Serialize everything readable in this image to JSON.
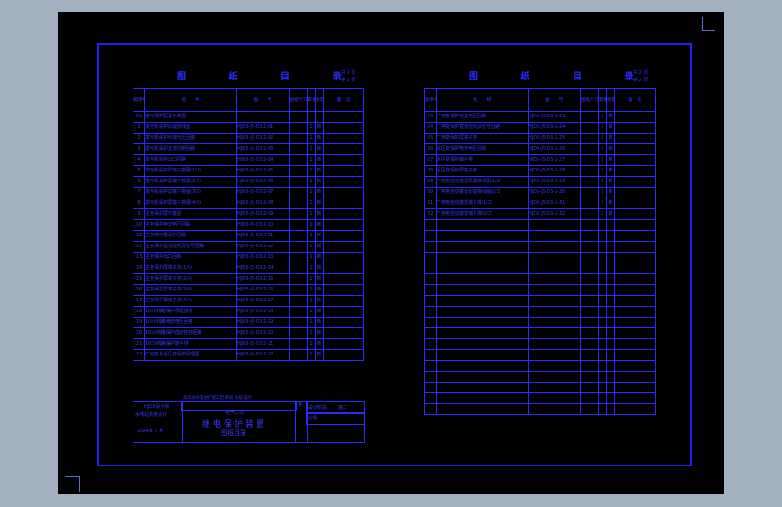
{
  "left_sheet": {
    "title": "图 纸 目 录",
    "page_total": "共 2 页",
    "page_no": "第 1 页",
    "headers": [
      "顺序号",
      "名　　称",
      "图　　号",
      "图纸尺寸",
      "数量",
      "张数",
      "备　注"
    ],
    "rows": [
      [
        "01",
        "继电保护配置示意图",
        "",
        "",
        "",
        "",
        ""
      ],
      [
        "1",
        "发电机保护原理接线图",
        "HJD3-J5-03-2-01",
        "",
        "1",
        "新",
        ""
      ],
      [
        "2",
        "发电机保护电流电压回路",
        "HJD3-J5-03-2-02",
        "",
        "1",
        "新",
        ""
      ],
      [
        "3",
        "发电机保护直流控制回路",
        "HJD3-J5-03-2-03",
        "",
        "1",
        "新",
        ""
      ],
      [
        "4",
        "发电机保护出口回路",
        "HJD3-J5-03-2-04",
        "",
        "1",
        "新",
        ""
      ],
      [
        "5",
        "发电机保护屏端子排图(1/3)",
        "HJD3-J5-03-2-05",
        "",
        "1",
        "新",
        ""
      ],
      [
        "6",
        "发电机保护屏端子排图(2/3)",
        "HJD3-J5-03-2-06",
        "",
        "1",
        "新",
        ""
      ],
      [
        "7",
        "发电机保护屏端子排图(3/3)",
        "HJD3-J5-03-2-07",
        "",
        "1",
        "新",
        ""
      ],
      [
        "8",
        "发电机保护屏端子排图(4/4)",
        "HJD3-J5-03-2-08",
        "",
        "1",
        "新",
        ""
      ],
      [
        "9",
        "主变保护屏布置图",
        "HJD3-J5-03-2-09",
        "",
        "1",
        "新",
        ""
      ],
      [
        "10",
        "主变保护电流电压回路",
        "HJD3-J5-03-2-10",
        "",
        "1",
        "新",
        ""
      ],
      [
        "11",
        "主变非电量保护回路",
        "HJD3-J5-03-2-11",
        "",
        "1",
        "新",
        ""
      ],
      [
        "12",
        "主变保护直流控制及信号回路",
        "HJD3-J5-03-2-12",
        "",
        "1",
        "新",
        ""
      ],
      [
        "13",
        "主变保护出口回路",
        "HJD3-J5-03-2-13",
        "",
        "1",
        "新",
        ""
      ],
      [
        "14",
        "主变保护屏端子排(1/4)",
        "HJD3-J5-03-2-14",
        "",
        "1",
        "新",
        ""
      ],
      [
        "15",
        "主变保护屏端子排(2/4)",
        "HJD3-J5-03-2-15",
        "",
        "1",
        "新",
        ""
      ],
      [
        "16",
        "主变保护屏端子排(3/4)",
        "HJD3-J5-03-2-16",
        "",
        "1",
        "新",
        ""
      ],
      [
        "17",
        "主变保护屏端子排(4/4)",
        "HJD3-J5-03-2-17",
        "",
        "1",
        "新",
        ""
      ],
      [
        "18",
        "10kV线路保护原理接线",
        "HJD3-J5-03-2-18",
        "",
        "1",
        "新",
        ""
      ],
      [
        "19",
        "10kV线路电流电压回路",
        "HJD3-J5-03-2-19",
        "",
        "1",
        "新",
        ""
      ],
      [
        "20",
        "10kV线路保护直流控制回路",
        "HJD3-J5-03-2-20",
        "",
        "1",
        "新",
        ""
      ],
      [
        "21",
        "10kV线路保护端子排",
        "HJD3-J5-03-2-21",
        "",
        "1",
        "新",
        ""
      ],
      [
        "22",
        "厂用变及近区变保护原理图",
        "HJD3-J5-03-2-22",
        "",
        "1",
        "新",
        ""
      ]
    ],
    "titleblock": {
      "org1": "HJD3设计院",
      "org2": "水电站机电设计",
      "date": "2004年 7 月",
      "proj_line": "高坝洲水电站扩建工程  审核  校核  设计",
      "dept": "电气二次",
      "name1": "继电保护装置",
      "name2": "图纸目录",
      "stage_label": "设计阶段",
      "stage": "施工",
      "scale_label": "比例",
      "scale": "",
      "side_mark": "卷"
    }
  },
  "right_sheet": {
    "title": "图 纸 目 录",
    "page_total": "共 2 页",
    "page_no": "第 2 页",
    "headers": [
      "顺序号",
      "名　　称",
      "图　　号",
      "图纸尺寸",
      "数量",
      "张数",
      "备　注"
    ],
    "rows": [
      [
        "23",
        "厂用变保护电流电压回路",
        "HJD3-J5-03-2-23",
        "",
        "1",
        "新",
        ""
      ],
      [
        "24",
        "厂用变保护直流控制及信号回路",
        "HJD3-J5-03-2-24",
        "",
        "1",
        "新",
        ""
      ],
      [
        "25",
        "厂用变保护屏端子排",
        "HJD3-J5-03-2-25",
        "",
        "1",
        "新",
        ""
      ],
      [
        "26",
        "近区变保护电流电压回路",
        "HJD3-J5-03-2-26",
        "",
        "1",
        "新",
        ""
      ],
      [
        "27",
        "近区变保护端子排",
        "HJD3-J5-03-2-27",
        "",
        "1",
        "新",
        ""
      ],
      [
        "28",
        "近区变保护屏端子排",
        "HJD3-J5-03-2-28",
        "",
        "1",
        "新",
        ""
      ],
      [
        "29",
        "厂用电自动装置原理接线图(1/2)",
        "HJD3-J5-03-2-29",
        "",
        "1",
        "新",
        ""
      ],
      [
        "30",
        "厂用电自动装置原理接线图(2/2)",
        "HJD3-J5-03-2-30",
        "",
        "1",
        "新",
        ""
      ],
      [
        "31",
        "厂用电自动装置端子排(1/2)",
        "HJD3-J5-03-2-31",
        "",
        "1",
        "新",
        ""
      ],
      [
        "32",
        "厂用电自动装置端子排(2/2)",
        "HJD3-J5-03-2-32",
        "",
        "1",
        "新",
        ""
      ]
    ],
    "empty_rows": 18
  }
}
